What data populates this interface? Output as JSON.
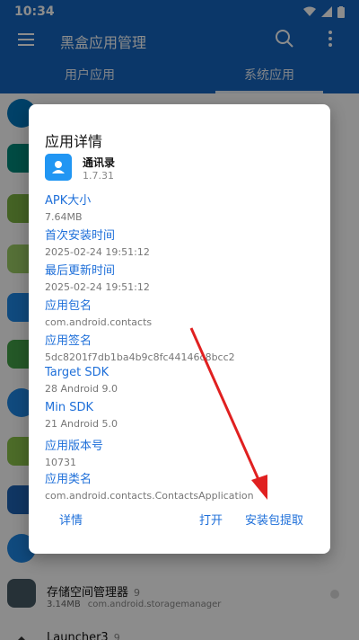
{
  "status_bar": {
    "time": "10:34"
  },
  "app_bar": {
    "title": "黑盒应用管理"
  },
  "tabs": [
    {
      "label": "用户应用",
      "active": false
    },
    {
      "label": "系统应用",
      "active": true
    }
  ],
  "list_items": [
    {
      "icon_name": "storage-manager-icon",
      "icon_color": "#455a64",
      "title": "存储空间管理器",
      "version": "9",
      "size": "3.14MB",
      "package": "com.android.storagemanager"
    },
    {
      "icon_name": "launcher-icon",
      "icon_color": "#333333",
      "title": "Launcher3",
      "version": "9",
      "size": "",
      "package": ""
    }
  ],
  "dialog": {
    "title": "应用详情",
    "app_name": "通讯录",
    "app_version": "1.7.31",
    "fields": [
      {
        "label": "APK大小",
        "value": "7.64MB"
      },
      {
        "label": "首次安装时间",
        "value": "2025-02-24 19:51:12"
      },
      {
        "label": "最后更新时间",
        "value": "2025-02-24 19:51:12"
      },
      {
        "label": "应用包名",
        "value": "com.android.contacts"
      },
      {
        "label": "应用签名",
        "value": "5dc8201f7db1ba4b9c8fc44146c8bcc2"
      },
      {
        "label": "Target SDK",
        "value": "28 Android 9.0"
      },
      {
        "label": "Min SDK",
        "value": "21 Android 5.0"
      },
      {
        "label": "应用版本号",
        "value": "10731"
      },
      {
        "label": "应用类名",
        "value": "com.android.contacts.ContactsApplication"
      }
    ],
    "buttons": {
      "details": "详情",
      "open": "打开",
      "extract": "安装包提取"
    }
  },
  "colors": {
    "primary": "#1565c0",
    "accent": "#1e6fd9",
    "arrow": "#e02020"
  }
}
